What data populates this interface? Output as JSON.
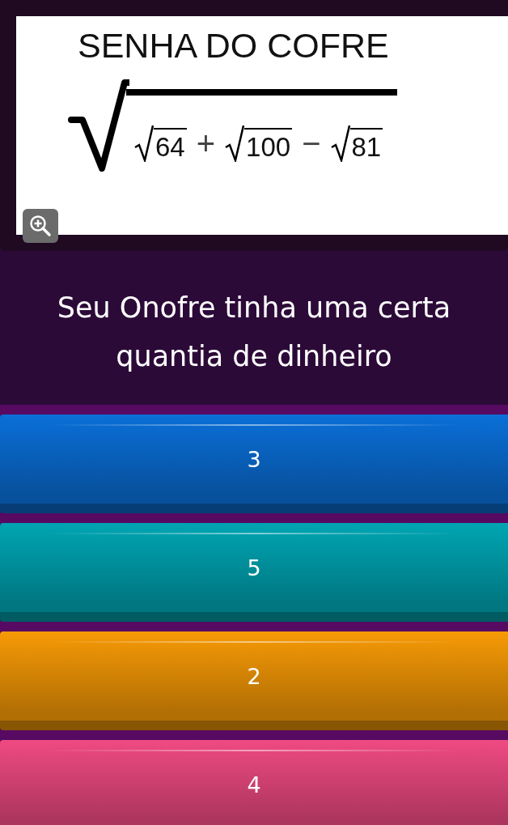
{
  "image_card": {
    "title": "SENHA DO COFRE",
    "expression": [
      {
        "kind": "root",
        "value": "64"
      },
      {
        "kind": "operator",
        "value": "+"
      },
      {
        "kind": "root",
        "value": "100"
      },
      {
        "kind": "operator",
        "value": "−"
      },
      {
        "kind": "root",
        "value": "81"
      }
    ]
  },
  "question": "Seu Onofre tinha uma certa quantia de dinheiro",
  "answers": [
    {
      "label": "3",
      "color": "#0a6fd8"
    },
    {
      "label": "5",
      "color": "#00a5b3"
    },
    {
      "label": "2",
      "color": "#f79a06"
    },
    {
      "label": "4",
      "color": "#ef4a82"
    }
  ]
}
